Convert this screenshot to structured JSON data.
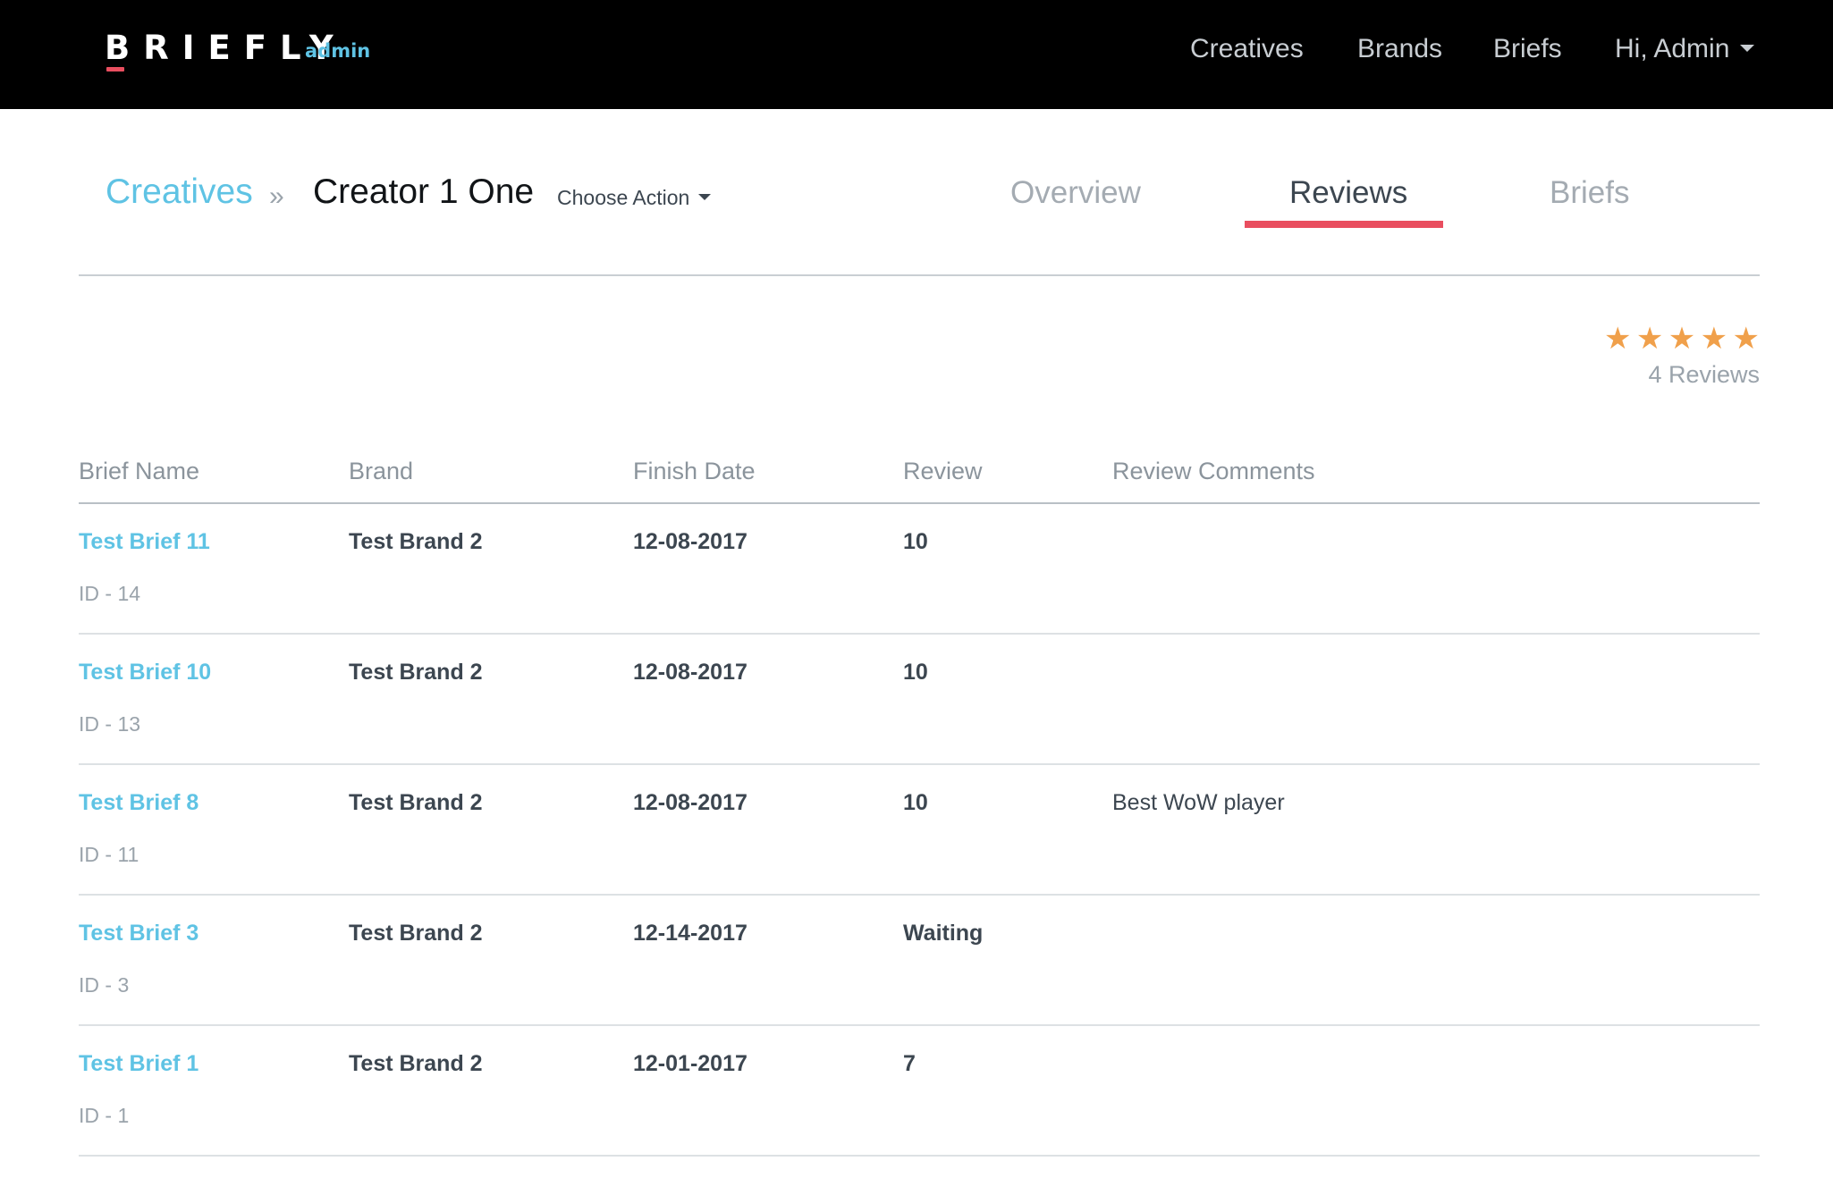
{
  "navbar": {
    "logo_text": "BRIEFLY",
    "logo_sub": "admin",
    "links": {
      "creatives": "Creatives",
      "brands": "Brands",
      "briefs": "Briefs"
    },
    "user_menu": "Hi, Admin"
  },
  "header": {
    "breadcrumb_root": "Creatives",
    "breadcrumb_separator": "»",
    "breadcrumb_current": "Creator 1 One",
    "choose_action": "Choose Action",
    "tabs": {
      "overview": "Overview",
      "reviews": "Reviews",
      "briefs": "Briefs"
    },
    "active_tab": "Reviews"
  },
  "rating": {
    "stars_filled": 5,
    "stars_total": 5,
    "star_glyph": "★",
    "reviews_count": "4 Reviews",
    "star_color": "#f0a04b"
  },
  "table": {
    "headers": {
      "brief_name": "Brief Name",
      "brand": "Brand",
      "finish_date": "Finish Date",
      "review": "Review",
      "review_comments": "Review Comments"
    },
    "rows": [
      {
        "brief_name": "Test Brief 11",
        "brief_id": "ID - 14",
        "brand": "Test Brand 2",
        "finish_date": "12-08-2017",
        "review": "10",
        "comment": ""
      },
      {
        "brief_name": "Test Brief 10",
        "brief_id": "ID - 13",
        "brand": "Test Brand 2",
        "finish_date": "12-08-2017",
        "review": "10",
        "comment": ""
      },
      {
        "brief_name": "Test Brief 8",
        "brief_id": "ID - 11",
        "brand": "Test Brand 2",
        "finish_date": "12-08-2017",
        "review": "10",
        "comment": "Best WoW player"
      },
      {
        "brief_name": "Test Brief 3",
        "brief_id": "ID - 3",
        "brand": "Test Brand 2",
        "finish_date": "12-14-2017",
        "review": "Waiting",
        "comment": ""
      },
      {
        "brief_name": "Test Brief 1",
        "brief_id": "ID - 1",
        "brand": "Test Brand 2",
        "finish_date": "12-01-2017",
        "review": "7",
        "comment": ""
      }
    ]
  },
  "colors": {
    "navbar_bg": "#000000",
    "link_accent": "#5fc3e4",
    "tab_underline": "#e94e5f"
  }
}
